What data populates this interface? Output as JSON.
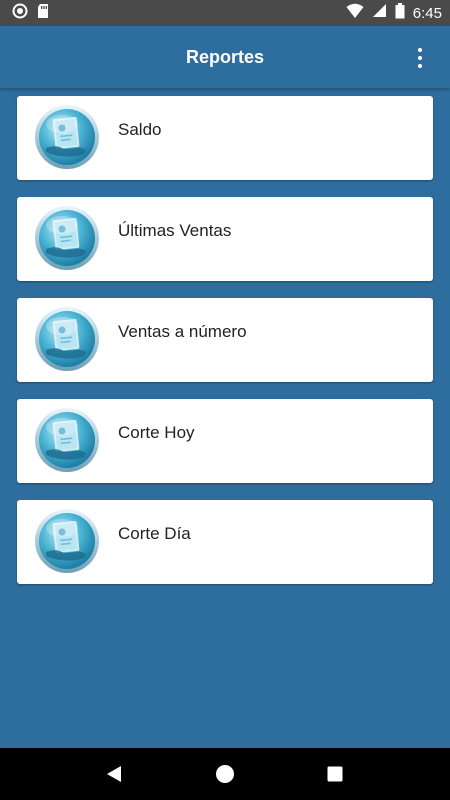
{
  "status_bar": {
    "time": "6:45",
    "icons": [
      "record-icon",
      "sd-card-icon",
      "wifi-icon",
      "signal-icon",
      "battery-icon"
    ]
  },
  "app_bar": {
    "title": "Reportes",
    "menu_icon": "more-vert-icon"
  },
  "reports": [
    {
      "label": "Saldo",
      "icon": "report-icon"
    },
    {
      "label": "Últimas Ventas",
      "icon": "report-icon"
    },
    {
      "label": "Ventas a número",
      "icon": "report-icon"
    },
    {
      "label": "Corte Hoy",
      "icon": "report-icon"
    },
    {
      "label": "Corte Día",
      "icon": "report-icon"
    }
  ],
  "nav_bar": {
    "icons": [
      "back-icon",
      "home-icon",
      "recents-icon"
    ]
  },
  "colors": {
    "primary": "#2e6e9e",
    "status_bar": "#4a4a4a",
    "card": "#ffffff",
    "icon_accent": "#3aa7c4"
  }
}
